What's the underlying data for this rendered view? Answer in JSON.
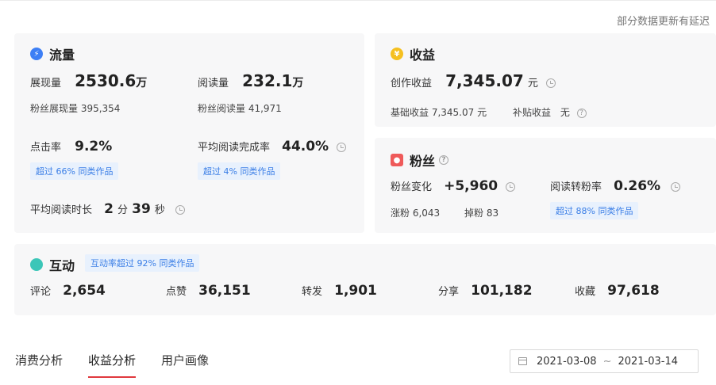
{
  "notice": "部分数据更新有延迟",
  "traffic": {
    "title": "流量",
    "impressions": {
      "label": "展现量",
      "value": "2530.6",
      "unit": "万"
    },
    "reads": {
      "label": "阅读量",
      "value": "232.1",
      "unit": "万"
    },
    "fan_impressions": "粉丝展现量 395,354",
    "fan_reads": "粉丝阅读量 41,971",
    "ctr": {
      "label": "点击率",
      "value": "9.2%",
      "badge": "超过 66% 同类作品"
    },
    "completion": {
      "label": "平均阅读完成率",
      "value": "44.0%",
      "badge": "超过 4% 同类作品"
    },
    "avg_time": {
      "label": "平均阅读时长",
      "min": "2",
      "min_unit": "分",
      "sec": "39",
      "sec_unit": "秒"
    }
  },
  "income": {
    "title": "收益",
    "creation": {
      "label": "创作收益",
      "value": "7,345.07",
      "unit": "元"
    },
    "base": "基础收益 7,345.07 元",
    "subsidy": {
      "label": "补贴收益",
      "value": "无"
    }
  },
  "fans": {
    "title": "粉丝",
    "change": {
      "label": "粉丝变化",
      "value": "+5,960"
    },
    "conversion": {
      "label": "阅读转粉率",
      "value": "0.26%",
      "badge": "超过 88% 同类作品"
    },
    "gain": "涨粉 6,043",
    "loss": "掉粉 83"
  },
  "interaction": {
    "title": "互动",
    "badge": "互动率超过 92% 同类作品",
    "items": [
      {
        "label": "评论",
        "value": "2,654"
      },
      {
        "label": "点赞",
        "value": "36,151"
      },
      {
        "label": "转发",
        "value": "1,901"
      },
      {
        "label": "分享",
        "value": "101,182"
      },
      {
        "label": "收藏",
        "value": "97,618"
      }
    ]
  },
  "tabs": [
    "消费分析",
    "收益分析",
    "用户画像"
  ],
  "active_tab": 1,
  "date_range": {
    "start": "2021-03-08",
    "sep": "~",
    "end": "2021-03-14"
  },
  "colors": {
    "accent": "#e0393e",
    "badge_text": "#3a7ee6",
    "badge_bg": "#e8f1fd",
    "card_bg": "#f7f7f8"
  },
  "icons": {
    "traffic": "lightning-icon",
    "income": "coin-icon",
    "fans": "user-icon",
    "interaction": "chat-bubble-icon"
  }
}
